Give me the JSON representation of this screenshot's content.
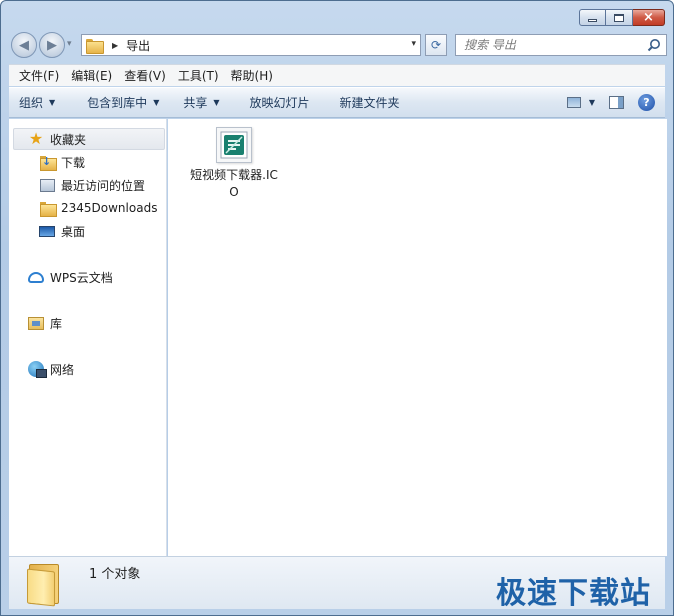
{
  "window": {
    "caption_buttons": {
      "minimize": "minimize",
      "maximize": "maximize",
      "close": "×"
    }
  },
  "address_bar": {
    "crumb": "导出",
    "history_dropdown": "▾",
    "path_dropdown": "▾",
    "refresh_glyph": "⟳"
  },
  "search": {
    "placeholder": "搜索 导出"
  },
  "menu": [
    "文件(F)",
    "编辑(E)",
    "查看(V)",
    "工具(T)",
    "帮助(H)"
  ],
  "toolbar": {
    "organize": "组织",
    "include_in_library": "包含到库中",
    "share": "共享",
    "slideshow": "放映幻灯片",
    "new_folder": "新建文件夹",
    "help": "?"
  },
  "navigation": {
    "favorites": "收藏夹",
    "downloads": "下载",
    "recent_places": "最近访问的位置",
    "downloads_2345": "2345Downloads",
    "desktop": "桌面",
    "wps_cloud": "WPS云文档",
    "libraries": "库",
    "network": "网络"
  },
  "files": [
    {
      "name": "短视频下载器.ICO",
      "icon": "ico-file-icon"
    }
  ],
  "details": {
    "count": "1 个对象"
  },
  "watermark": "极速下载站",
  "colors": {
    "accent": "#1f62a8",
    "toolbar_text": "#1e395b",
    "folder": "#e6b44a"
  }
}
